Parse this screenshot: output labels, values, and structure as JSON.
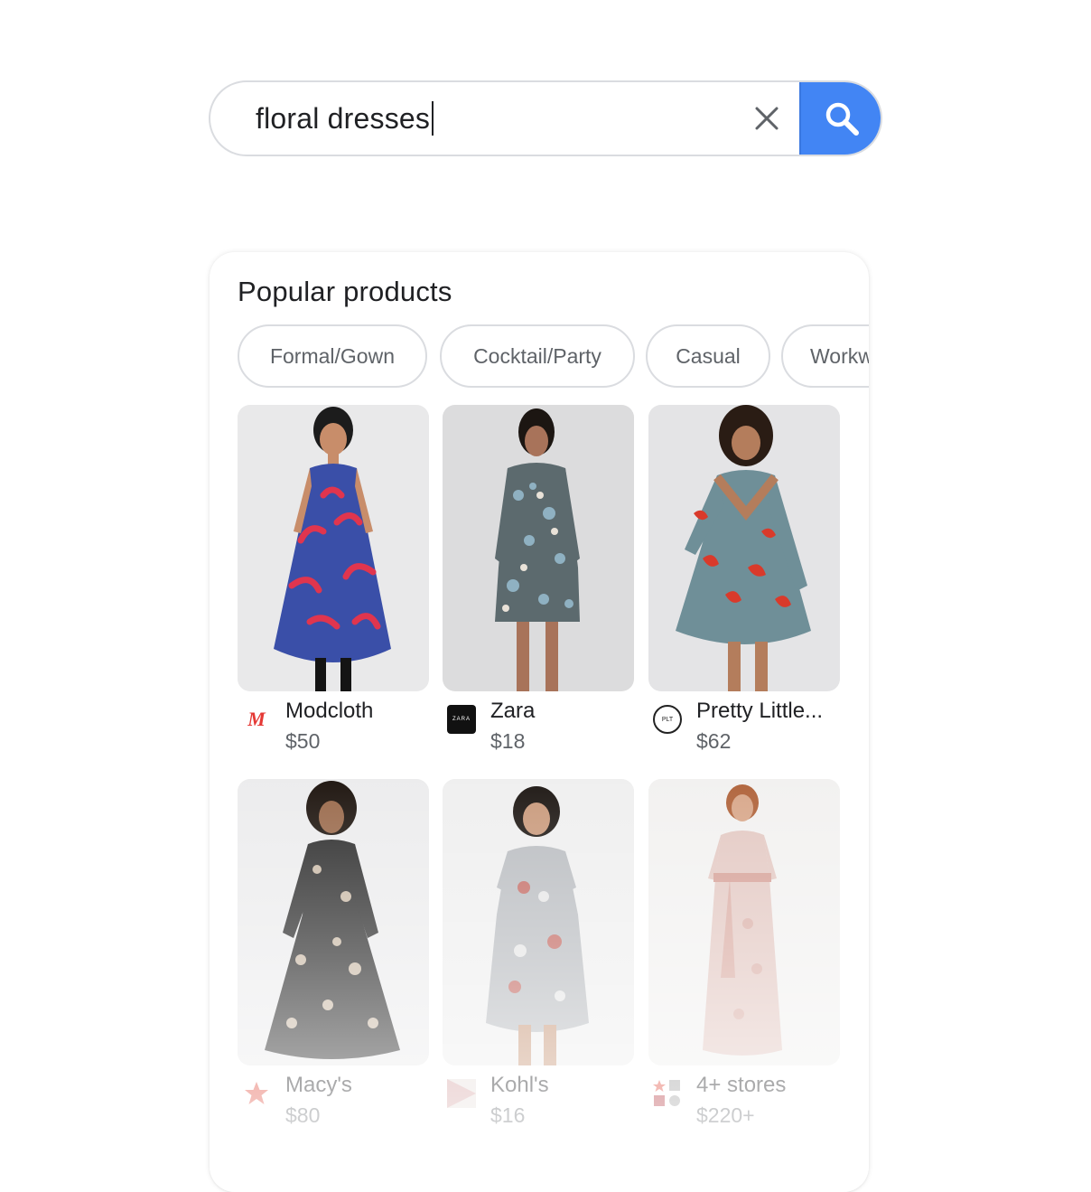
{
  "search": {
    "query": "floral dresses",
    "clear_icon": "close-icon",
    "search_icon": "search-icon",
    "button_color": "#4285f4"
  },
  "card": {
    "title": "Popular products",
    "chips": [
      {
        "label": "Formal/Gown"
      },
      {
        "label": "Cocktail/Party"
      },
      {
        "label": "Casual"
      },
      {
        "label": "Workw"
      }
    ],
    "products": [
      {
        "store": "Modcloth",
        "price": "$50",
        "logo": "M",
        "logo_color": "#e53935",
        "dress_color": "#3a4fa8",
        "accent_color": "#e0354e"
      },
      {
        "store": "Zara",
        "price": "$18",
        "logo": "ZARA",
        "logo_color": "#111111",
        "dress_color": "#5c6a6e",
        "accent_color": "#8fb1c2"
      },
      {
        "store": "Pretty Little...",
        "price": "$62",
        "logo": "PLT",
        "logo_color": "#222222",
        "dress_color": "#6f8f98",
        "accent_color": "#d93a2b"
      },
      {
        "store": "Macy's",
        "price": "$80",
        "logo": "star",
        "logo_color": "#e04b3c",
        "dress_color": "#2b2b2b",
        "accent_color": "#c9b9a6"
      },
      {
        "store": "Kohl's",
        "price": "$16",
        "logo": "K",
        "logo_color": "#b2323a",
        "dress_color": "#b9bcc0",
        "accent_color": "#c6564c"
      },
      {
        "store": "4+ stores",
        "price": "$220+",
        "logo": "stores",
        "logo_color": "#777777",
        "dress_color": "#e3c8c2",
        "accent_color": "#d59f96"
      }
    ]
  }
}
